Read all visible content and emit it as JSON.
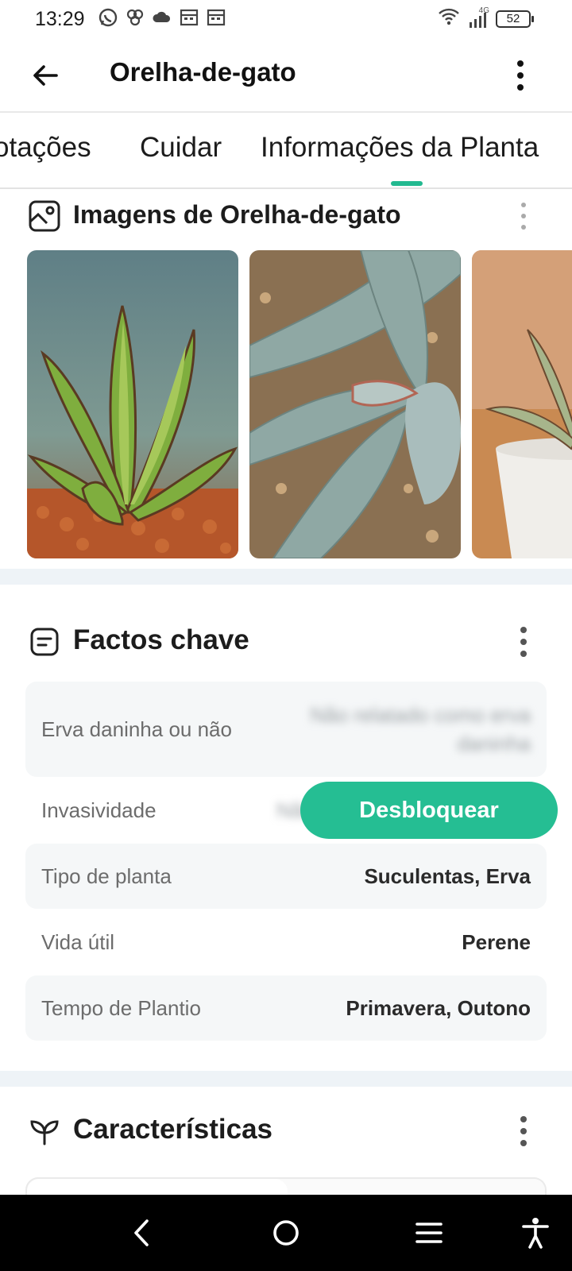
{
  "status_bar": {
    "time": "13:29",
    "network_label": "4G",
    "battery": "52"
  },
  "app_bar": {
    "title": "Orelha-de-gato"
  },
  "tabs": [
    {
      "label": "otações"
    },
    {
      "label": "Cuidar"
    },
    {
      "label": "Informações da Planta",
      "active": true
    }
  ],
  "images_section": {
    "title": "Imagens de Orelha-de-gato"
  },
  "key_facts": {
    "title": "Factos chave",
    "rows": [
      {
        "label": "Erva daninha ou não",
        "value": "Não relatado como erva daninha",
        "locked": true
      },
      {
        "label": "Invasividade",
        "value": "Não",
        "locked": true
      },
      {
        "label": "Tipo de planta",
        "value": "Suculentas, Erva"
      },
      {
        "label": "Vida útil",
        "value": "Perene"
      },
      {
        "label": "Tempo de Plantio",
        "value": "Primavera, Outono"
      }
    ],
    "unlock_label": "Desbloquear"
  },
  "characteristics": {
    "title": "Características"
  },
  "colors": {
    "accent": "#25be93",
    "band": "#eef3f7",
    "row_shade": "#f5f7f8"
  }
}
